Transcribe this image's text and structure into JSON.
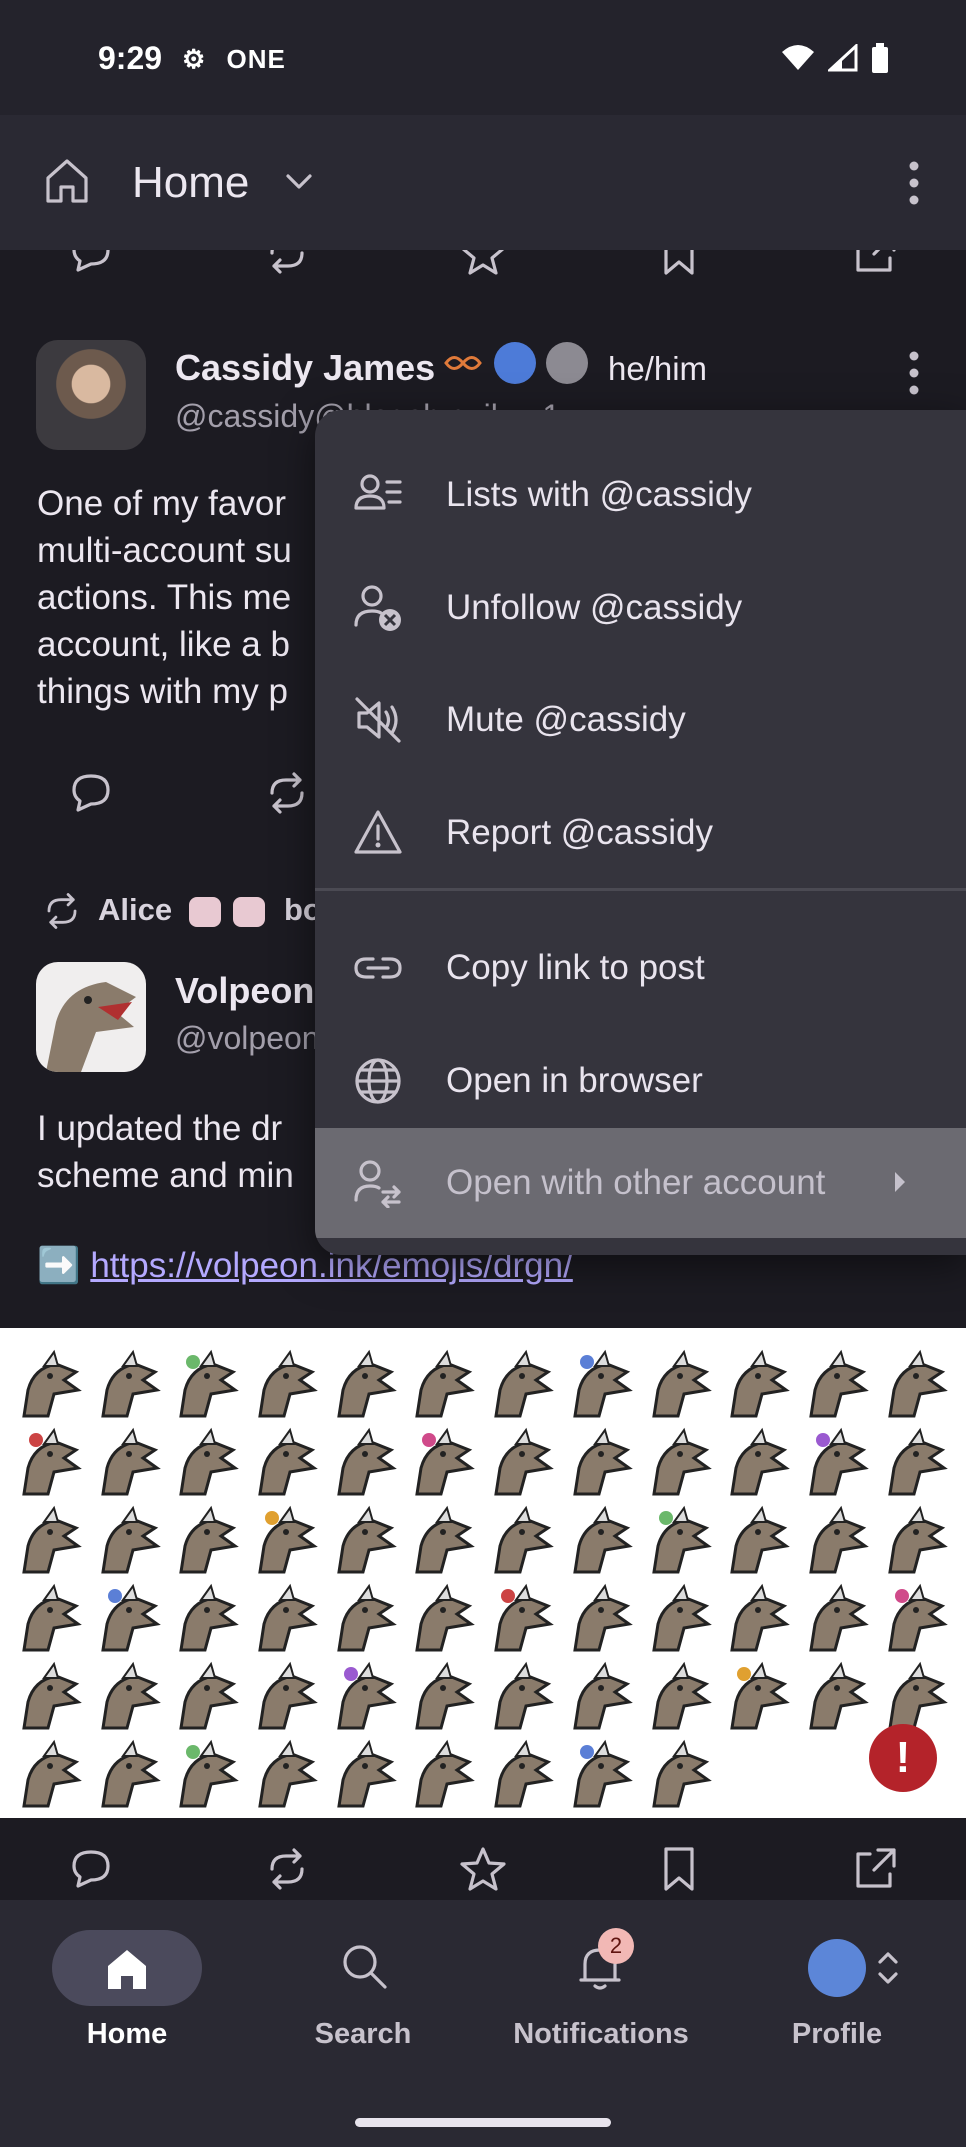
{
  "status": {
    "time": "9:29",
    "carrier": "ONE"
  },
  "topbar": {
    "title": "Home"
  },
  "post1": {
    "author": "Cassidy James",
    "handle": "@cassidy@blogsh.c..ik....1",
    "pronouns": "he/him",
    "body": "One of my favor\nmulti-account su\nactions. This me\naccount, like a b\nthings with my p"
  },
  "boost": {
    "booster": "Alice",
    "text": "boo"
  },
  "post2": {
    "author": "Volpeon",
    "handle": "@volpeon",
    "body": "I updated the dr\nscheme and min",
    "link_prefix": "➡️",
    "link": "https://volpeon.ink/emojis/drgn/"
  },
  "menu": {
    "items": [
      {
        "label": "Lists with @cassidy",
        "icon": "people-list-icon"
      },
      {
        "label": "Unfollow @cassidy",
        "icon": "unfollow-icon"
      },
      {
        "label": "Mute @cassidy",
        "icon": "mute-icon"
      },
      {
        "label": "Report @cassidy",
        "icon": "warning-icon"
      },
      {
        "label": "Copy link to post",
        "icon": "link-icon"
      },
      {
        "label": "Open in browser",
        "icon": "globe-icon"
      },
      {
        "label": "Open with other account",
        "icon": "switch-account-icon"
      }
    ]
  },
  "nav": {
    "home": "Home",
    "search": "Search",
    "notifications": "Notifications",
    "notifications_badge": "2",
    "profile": "Profile"
  },
  "alert": "!"
}
